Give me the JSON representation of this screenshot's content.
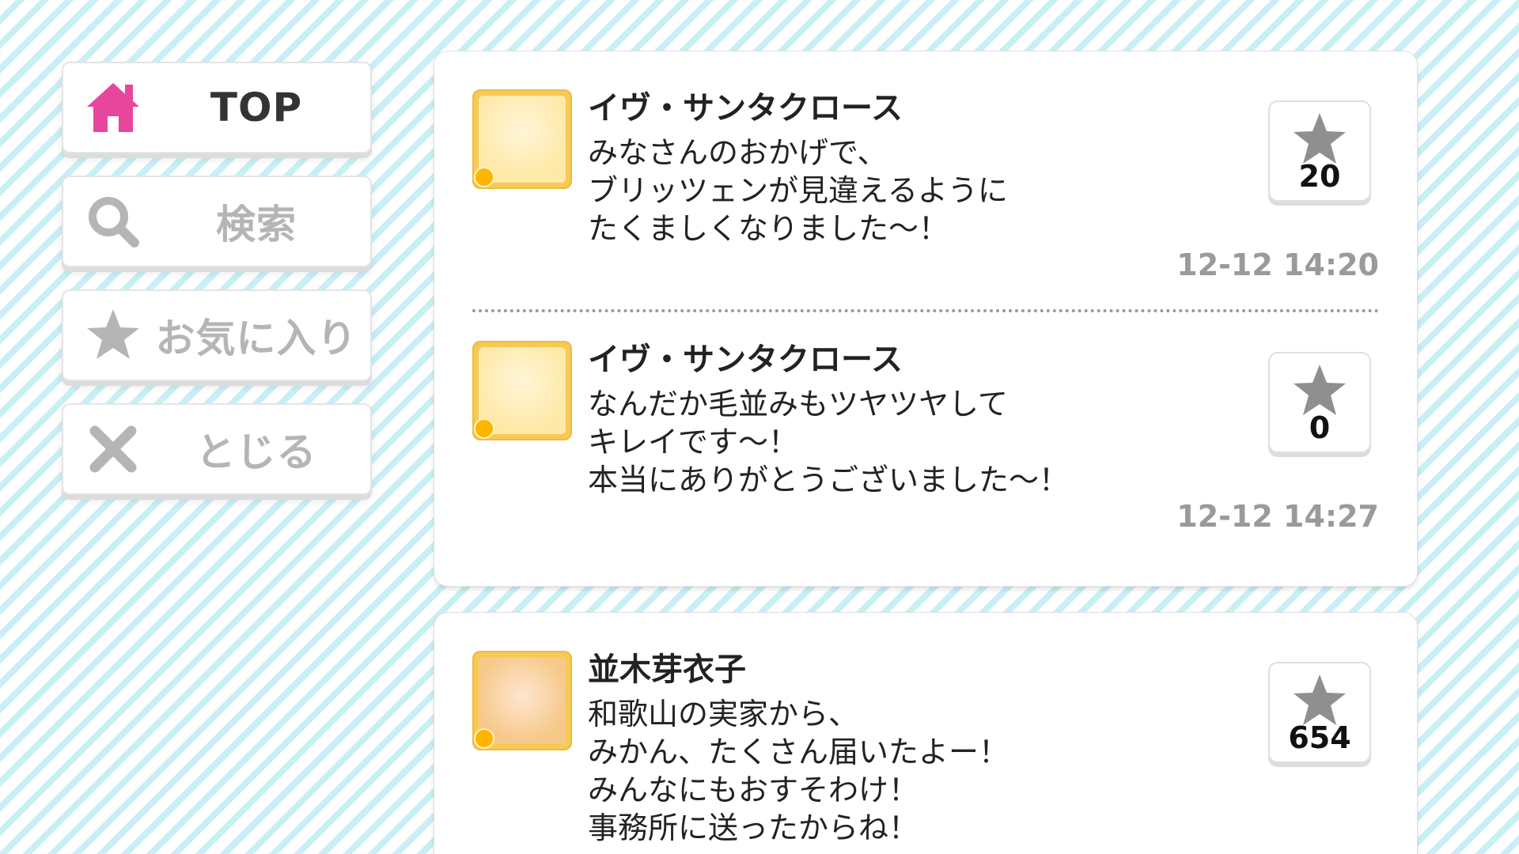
{
  "sidebar": {
    "items": [
      {
        "label": "TOP",
        "icon": "home-icon",
        "active": true
      },
      {
        "label": "検索",
        "icon": "search-icon",
        "active": false
      },
      {
        "label": "お気に入り",
        "icon": "star-icon",
        "active": false
      },
      {
        "label": "とじる",
        "icon": "close-icon",
        "active": false
      }
    ]
  },
  "colors": {
    "accent": "#e8459c",
    "inactive": "#b5b5b5",
    "timestamp": "#9a9a9a",
    "star": "#8f8f8f"
  },
  "posts": [
    {
      "name": "イヴ・サンタクロース",
      "message": "みなさんのおかげで、\nブリッツェンが見違えるように\nたくましくなりました～！",
      "likes": "20",
      "time": "12-12 14:20"
    },
    {
      "name": "イヴ・サンタクロース",
      "message": "なんだか毛並みもツヤツヤして\nキレイです～！\n本当にありがとうございました～！",
      "likes": "0",
      "time": "12-12 14:27"
    },
    {
      "name": "並木芽衣子",
      "message": "和歌山の実家から、\nみかん、たくさん届いたよー！\nみんなにもおすそわけ！\n事務所に送ったからね！",
      "likes": "654",
      "time": ""
    }
  ]
}
